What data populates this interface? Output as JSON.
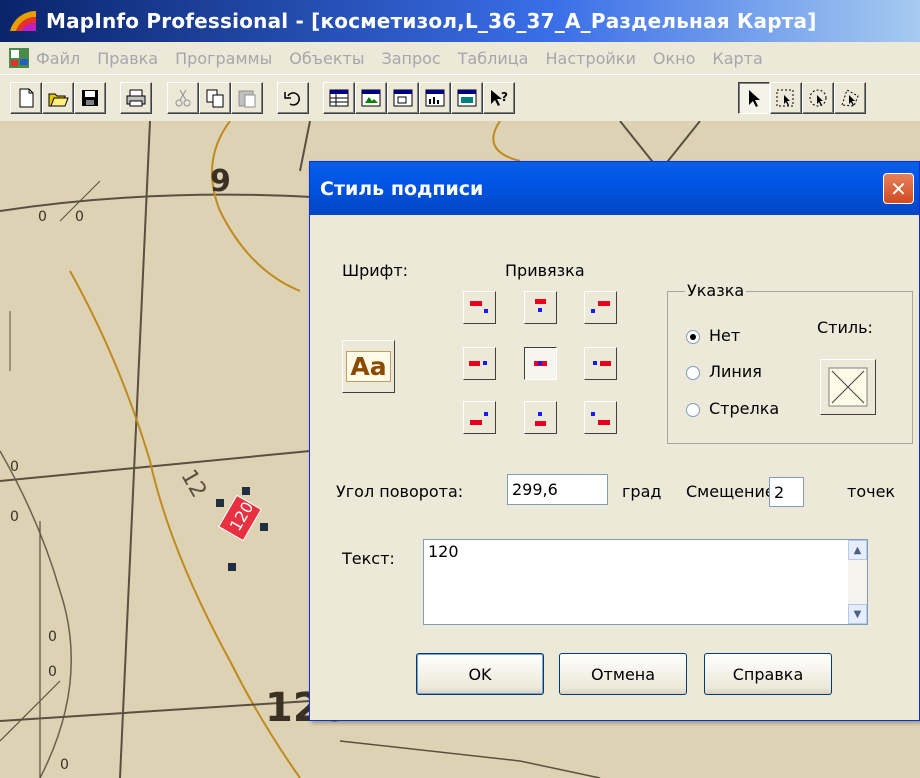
{
  "window": {
    "title": "MapInfo Professional - [косметизол,L_36_37_А_Раздельная Карта]"
  },
  "menu": [
    "Файл",
    "Правка",
    "Программы",
    "Объекты",
    "Запрос",
    "Таблица",
    "Настройки",
    "Окно",
    "Карта"
  ],
  "toolbar": {
    "buttons": [
      "new-icon",
      "open-icon",
      "save-icon",
      "print-icon",
      "cut-icon",
      "copy-icon",
      "paste-icon",
      "undo-icon",
      "browser-icon",
      "map-icon",
      "layout-icon",
      "graph-icon",
      "legend-icon",
      "help-pointer-icon",
      "select-icon",
      "marquee-select-icon",
      "radius-select-icon",
      "polygon-select-icon"
    ]
  },
  "map": {
    "labels": [
      "9",
      "0",
      "0",
      "0",
      "0",
      "12",
      "120",
      "120",
      "12",
      "0",
      "0",
      "0"
    ]
  },
  "dialog": {
    "title": "Стиль подписи",
    "close": "✕",
    "font_label": "Шрифт:",
    "font_sample": "Aa",
    "anchor_label": "Привязка",
    "pointer": {
      "legend": "Указка",
      "options": [
        "Нет",
        "Линия",
        "Стрелка"
      ],
      "selected": "Нет",
      "style_label": "Стиль:"
    },
    "angle_label": "Угол поворота:",
    "angle_value": "299,6",
    "angle_unit": "град",
    "offset_label": "Смещение",
    "offset_value": "2",
    "offset_unit": "точек",
    "text_label": "Текст:",
    "text_value": "120",
    "buttons": {
      "ok": "OK",
      "cancel": "Отмена",
      "help": "Справка"
    }
  },
  "colors": {
    "title_bar": "#0a246a",
    "dialog_title": "#0054e3",
    "anchor_red": "#e8001c",
    "anchor_blue": "#1a1aff",
    "map_bg": "#ddd3b4"
  }
}
